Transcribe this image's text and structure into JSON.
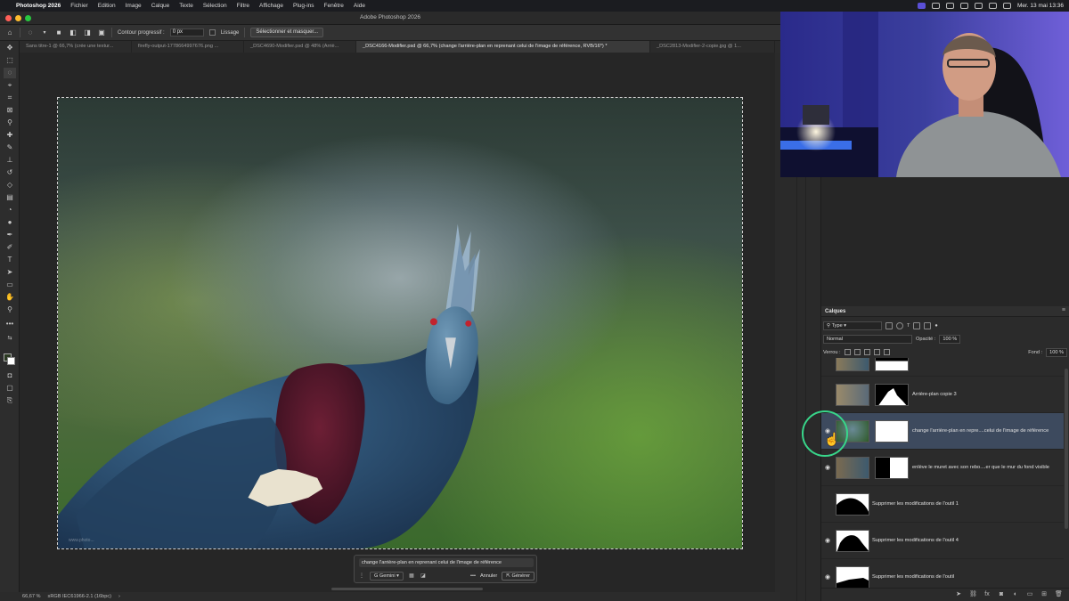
{
  "menubar": {
    "app_name": "Photoshop 2026",
    "items": [
      "Fichier",
      "Edition",
      "Image",
      "Calque",
      "Texte",
      "Sélection",
      "Filtre",
      "Affichage",
      "Plug-ins",
      "Fenêtre",
      "Aide"
    ],
    "clock": "Mer. 13 mai  13:36"
  },
  "window": {
    "title": "Adobe Photoshop 2026"
  },
  "options": {
    "feather_label": "Contour progressif :",
    "feather_value": "0 px",
    "antialias_label": "Lissage",
    "select_mask_button": "Sélectionner et masquer..."
  },
  "tabs": [
    {
      "label": "Sans titre-1 @ 66,7% (crée une textur...",
      "active": false
    },
    {
      "label": "firefly-output-1778664997676.png ...",
      "active": false
    },
    {
      "label": "_DSC4690-Modifier.psd @ 48% (Arriè...",
      "active": false
    },
    {
      "label": "_DSC4166-Modifier.psd @ 66,7% (change l'arrière-plan en reprenant celui de l'image de référence, RVB/16*) *",
      "active": true
    },
    {
      "label": "_DSC2813-Modifier-2-copie.jpg @ 1...",
      "active": false
    }
  ],
  "canvas": {
    "watermark": "www.photo..."
  },
  "contextual_bar": {
    "prompt": "change l'arrière-plan en reprenant celui de l'image de référence",
    "model": "Gemini",
    "more": "•••",
    "cancel": "Annuler",
    "generate": "Générer"
  },
  "status": {
    "zoom": "66,67 %",
    "profile": "sRGB IEC61966-2.1 (16bpc)",
    "arrow": "›"
  },
  "layers_panel": {
    "title": "Calques",
    "filter": "Type",
    "blend_mode": "Normal",
    "opacity_label": "Opacité :",
    "opacity": "100 %",
    "lock_label": "Verrou :",
    "fill_label": "Fond :",
    "fill": "100 %",
    "layers": [
      {
        "name": "",
        "visible": false,
        "selected": false
      },
      {
        "name": "Arrière-plan copie 3",
        "visible": false,
        "selected": false
      },
      {
        "name": "change l'arrière-plan en repre....celui de l'image de référence",
        "visible": true,
        "selected": true
      },
      {
        "name": "enlève le muret avec son rebo....er que le mur du fond visible",
        "visible": true,
        "selected": false
      },
      {
        "name": "Supprimer les modifications de l'outil 1",
        "visible": false,
        "selected": false
      },
      {
        "name": "Supprimer les modifications de l'outil 4",
        "visible": true,
        "selected": false
      },
      {
        "name": "Supprimer les modifications de l'outil",
        "visible": true,
        "selected": false
      }
    ]
  },
  "colors": {
    "selection_ring": "#38d68a",
    "selected_layer": "#3d4a5e",
    "webcam_light": "#5a4fd6"
  }
}
